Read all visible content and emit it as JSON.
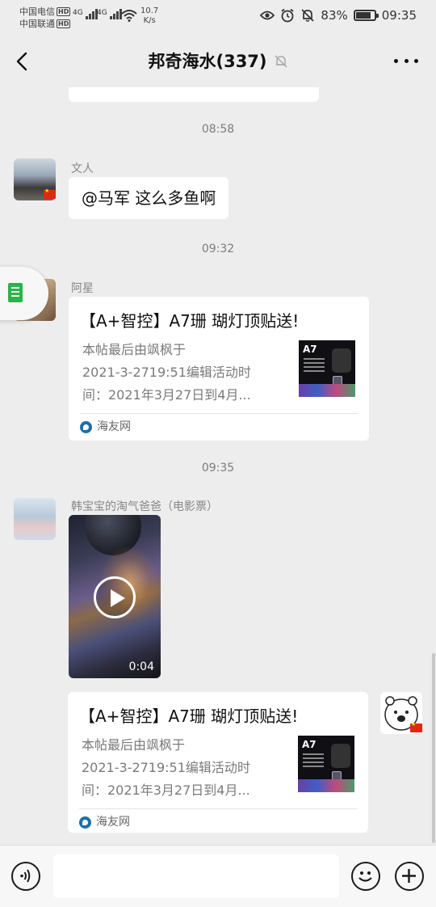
{
  "status_bar": {
    "carrier1": "中国电信",
    "carrier2": "中国联通",
    "hd": "HD",
    "network1": "4G",
    "network2": "4G",
    "speed_value": "10.7",
    "speed_unit": "K/s",
    "battery": "83%",
    "battery_level": 0.83,
    "time": "09:35"
  },
  "header": {
    "title": "邦奇海水(337)"
  },
  "messages": {
    "ts1": "08:58",
    "m1_name": "文人",
    "m1_text": "@马军  这么多鱼啊",
    "ts2": "09:32",
    "m2_name": "阿星",
    "ts3": "09:35",
    "m3_name": "韩宝宝的淘气爸爸（电影票）",
    "m3_video_duration": "0:04"
  },
  "card1": {
    "title": "【A+智控】A7珊 瑚灯顶贴送!",
    "desc1": "本帖最后由飒枫于",
    "desc2": "2021-3-2719:51编辑活动时",
    "desc3": "间：2021年3月27日到4月...",
    "thumb_label": "A7",
    "source": "海友网"
  },
  "card2": {
    "title": "【A+智控】A7珊 瑚灯顶贴送!",
    "desc1": "本帖最后由飒枫于",
    "desc2": "2021-3-2719:51编辑活动时",
    "desc3": "间：2021年3月27日到4月...",
    "thumb_label": "A7",
    "source": "海友网"
  },
  "colors": {
    "background": "#ededed",
    "bubble": "#ffffff",
    "flag_red": "#de2910",
    "float_green": "#2bb24c"
  },
  "icons": [
    "back-arrow-icon",
    "mute-bell-icon",
    "more-icon",
    "voice-icon",
    "emoji-icon",
    "plus-icon",
    "play-icon",
    "source-icon",
    "doc-icon"
  ]
}
